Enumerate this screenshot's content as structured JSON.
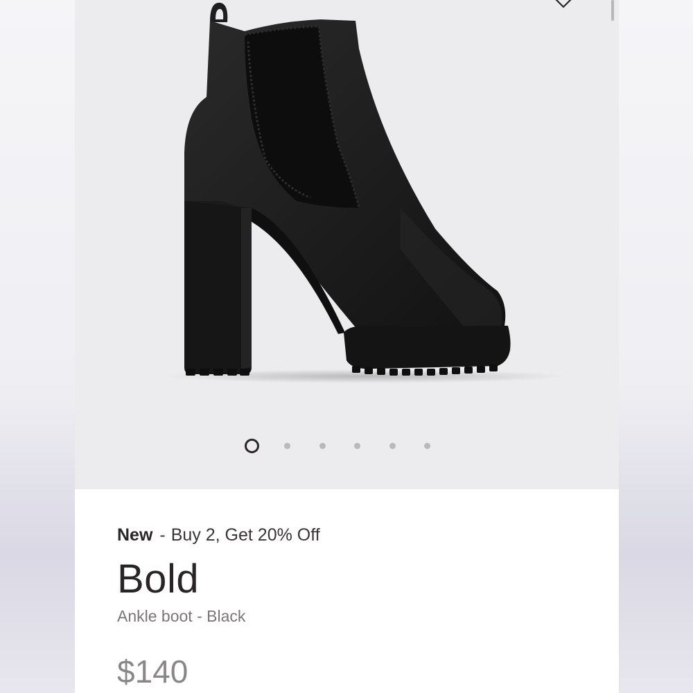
{
  "gallery": {
    "image_alt": "Bold black ankle boot",
    "slide_count": 6,
    "active_slide": 1
  },
  "product": {
    "badge": "New",
    "separator": "-",
    "promo": "Buy 2, Get 20% Off",
    "name": "Bold",
    "subtitle": "Ankle boot - Black",
    "price": "$140"
  },
  "colors": {
    "gallery_bg": "#ecebee",
    "text_primary": "#2a2427",
    "text_muted": "#7a7678",
    "boot": "#1a1a1a"
  },
  "icons": {
    "wishlist": "heart-outline-icon"
  }
}
